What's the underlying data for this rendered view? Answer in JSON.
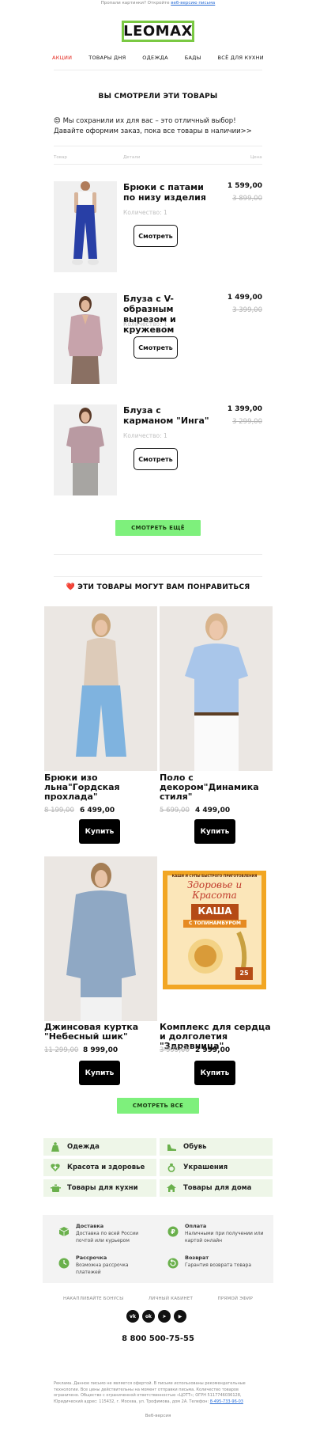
{
  "preheader": {
    "text": "Пропали картинки? Откройте ",
    "link": "веб-версию письма"
  },
  "logo": {
    "text": "LEOMAX",
    "border_color": "#7ac943"
  },
  "nav": [
    "АКЦИИ",
    "ТОВАРЫ ДНЯ",
    "ОДЕЖДА",
    "БАДЫ",
    "ВСЁ ДЛЯ КУХНИ"
  ],
  "viewed": {
    "title": "ВЫ СМОТРЕЛИ ЭТИ ТОВАРЫ",
    "intro": "😍 Мы сохранили их для вас – это отличный выбор! Давайте оформим заказ, пока все товары в наличии>>",
    "col_product": "Товар",
    "col_details": "Детали",
    "col_price": "Цена",
    "items": [
      {
        "name": "Брюки с патами по низу изделия",
        "price": "1 599,00",
        "old_price": "3 899,00",
        "qty": "Количество: 1",
        "button": "Смотреть"
      },
      {
        "name": "Блуза с V-образным вырезом и кружевом",
        "price": "1 499,00",
        "old_price": "3 399,00",
        "qty": "Количество: 1",
        "button": "Смотреть"
      },
      {
        "name": "Блуза с карманом \"Инга\"",
        "price": "1 399,00",
        "old_price": "3 299,00",
        "qty": "Количество: 1",
        "button": "Смотреть"
      }
    ],
    "more_button": "СМОТРЕТЬ ЕЩЁ"
  },
  "recommended": {
    "title": "❤️ ЭТИ ТОВАРЫ МОГУТ ВАМ ПОНРАВИТЬСЯ",
    "items": [
      {
        "name": "Брюки изо льна\"Гордская прохлада\"",
        "old_price": "8 199,00",
        "price": "6 499,00",
        "button": "Купить"
      },
      {
        "name": "Поло с декором\"Динамика стиля\"",
        "old_price": "5 699,00",
        "price": "4 499,00",
        "button": "Купить"
      },
      {
        "name": "Джинсовая куртка \"Небесный шик\"",
        "old_price": "11 299,00",
        "price": "8 999,00",
        "button": "Купить"
      },
      {
        "name": "Комплекс для сердца и долголетия \"Здравница\"",
        "old_price": "3 999,00",
        "price": "2 999,00",
        "button": "Купить"
      }
    ],
    "all_button": "СМОТРЕТЬ ВСЕ",
    "package": {
      "top_band": "КАШИ И СУПЫ БЫСТРОГО ПРИГОТОВЛЕНИЯ",
      "brand": "Здоровье и Красота",
      "product": "КАША",
      "subtitle": "С ТОПИНАМБУРОМ",
      "badge": "25"
    }
  },
  "categories": [
    "Одежда",
    "Обувь",
    "Красота и здоровье",
    "Украшения",
    "Товары для кухни",
    "Товары для дома"
  ],
  "info": [
    {
      "title": "Доставка",
      "desc": "Доставка по всей России почтой или курьером"
    },
    {
      "title": "Оплата",
      "desc": "Наличными при получении или картой онлайн"
    },
    {
      "title": "Рассрочка",
      "desc": "Возможна рассрочка платежей"
    },
    {
      "title": "Возврат",
      "desc": "Гарантия возврата товара"
    }
  ],
  "footer_links": [
    "НАКАПЛИВАЙТЕ БОНУСЫ",
    "ЛИЧНЫЙ КАБИНЕТ",
    "ПРЯМОЙ ЭФИР"
  ],
  "social": [
    "vk",
    "ok",
    "tg",
    "yt"
  ],
  "phone": "8 800 500-75-55",
  "legal": {
    "text": "Реклама. Данное письмо не является офертой. В письме использованы рекомендательные технологии. Все цены действительны на момент отправки письма. Количество товаров ограничено. Общество с ограниченной ответственностью «ЦОТТ»; ОГРН 5117746036128, Юридический адрес: 115432, г. Москва, ул. Трофимова, дом 2А. Телефон: ",
    "phone_link": "8-495-733-96-03"
  },
  "web_version": "Веб-версия",
  "colors": {
    "accent_red": "#e4281e",
    "green_button": "#7ef07c",
    "category_bg": "#eef6e8",
    "logo_green": "#7ac943"
  }
}
